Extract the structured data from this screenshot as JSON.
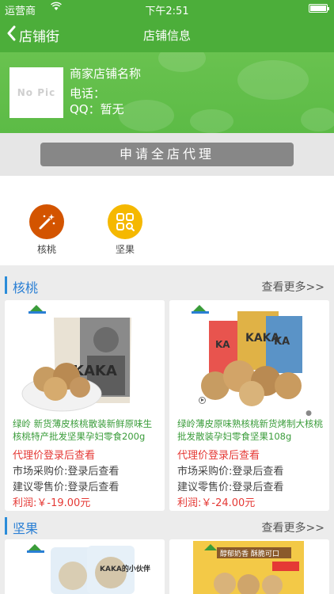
{
  "status_bar": {
    "carrier": "运营商",
    "time": "下午2:51"
  },
  "nav": {
    "back_label": "店铺街",
    "title": "店铺信息"
  },
  "shop": {
    "logo_placeholder": "No Pic",
    "name": "商家店铺名称",
    "phone": "电话：",
    "qq": "QQ：暂无"
  },
  "apply_button": "申请全店代理",
  "categories": [
    {
      "label": "核桃",
      "icon": "magic-wand-icon",
      "color": "#d35400"
    },
    {
      "label": "坚果",
      "icon": "grid-search-icon",
      "color": "#f5b800"
    }
  ],
  "sections": [
    {
      "title": "核桃",
      "more": "查看更多>>",
      "products": [
        {
          "name": "绿岭 新货薄皮核桃散装新鲜原味生核桃特产批发坚果孕妇零食200g",
          "agent_price": "代理价登录后查看",
          "market_price": "市场采购价:登录后查看",
          "retail_price": "建议零售价:登录后查看",
          "profit": "利润:￥-19.00元"
        },
        {
          "name": "绿岭薄皮原味熟核桃新货烤制大核桃批发散装孕妇零食坚果108g",
          "agent_price": "代理价登录后查看",
          "market_price": "市场采购价:登录后查看",
          "retail_price": "建议零售价:登录后查看",
          "profit": "利润:￥-24.00元"
        }
      ]
    },
    {
      "title": "坚果",
      "more": "查看更多>>",
      "products": []
    }
  ],
  "image_text": {
    "brand": "KAKA",
    "brand2": "KAKA的小伙伴",
    "tagline": "醇郁奶香 酥脆可口"
  }
}
